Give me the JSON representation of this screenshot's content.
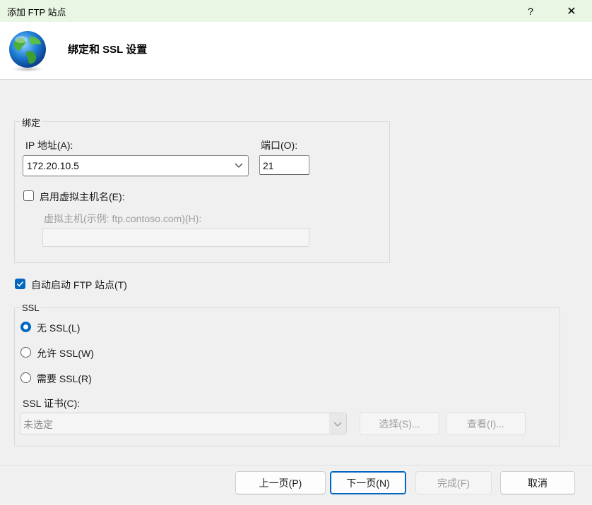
{
  "window": {
    "title": "添加 FTP 站点",
    "help_glyph": "?",
    "close_glyph": "✕",
    "header_title": "绑定和 SSL 设置",
    "header_icon": "globe-icon"
  },
  "binding": {
    "group_label": "绑定",
    "ip_label": "IP 地址(A):",
    "ip_value": "172.20.10.5",
    "port_label": "端口(O):",
    "port_value": "21",
    "enable_vhost_label": "启用虚拟主机名(E):",
    "enable_vhost_checked": false,
    "vhost_label": "虚拟主机(示例: ftp.contoso.com)(H):",
    "vhost_value": ""
  },
  "autostart": {
    "label": "自动启动 FTP 站点(T)",
    "checked": true
  },
  "ssl": {
    "group_label": "SSL",
    "options": [
      {
        "label": "无 SSL(L)",
        "checked": true
      },
      {
        "label": "允许 SSL(W)",
        "checked": false
      },
      {
        "label": "需要 SSL(R)",
        "checked": false
      }
    ],
    "cert_label": "SSL 证书(C):",
    "cert_value": "未选定",
    "select_button": "选择(S)...",
    "view_button": "查看(I)..."
  },
  "footer": {
    "prev": "上一页(P)",
    "next": "下一页(N)",
    "finish": "完成(F)",
    "cancel": "取消"
  },
  "colors": {
    "accent": "#0067c0",
    "titlebar_bg": "#eaf6e4",
    "dialog_bg": "#f0f0f0"
  }
}
